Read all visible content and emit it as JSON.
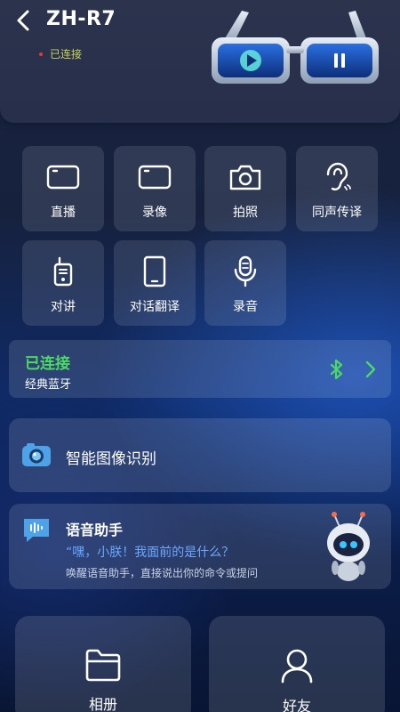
{
  "header": {
    "device_name": "ZH-R7",
    "connection_status": "已连接"
  },
  "features": [
    {
      "label": "直播",
      "icon": "video-camera-icon"
    },
    {
      "label": "录像",
      "icon": "video-record-icon"
    },
    {
      "label": "拍照",
      "icon": "camera-icon"
    },
    {
      "label": "同声传译",
      "icon": "ear-icon"
    },
    {
      "label": "对讲",
      "icon": "walkie-talkie-icon"
    },
    {
      "label": "对话翻译",
      "icon": "phone-icon"
    },
    {
      "label": "录音",
      "icon": "microphone-icon"
    }
  ],
  "bluetooth": {
    "status": "已连接",
    "type": "经典蓝牙",
    "status_color": "#4cd964"
  },
  "image_recognition": {
    "label": "智能图像识别"
  },
  "voice_assistant": {
    "title": "语音助手",
    "prompt": "“嘿，小朕！我面前的是什么？",
    "hint": "唤醒语音助手，直接说出你的命令或提问"
  },
  "bottom": [
    {
      "label": "相册",
      "icon": "folder-icon"
    },
    {
      "label": "好友",
      "icon": "user-icon"
    }
  ],
  "colors": {
    "accent_blue": "#6aa8ff",
    "connected_green": "#4cd964",
    "status_yellow": "#c8d45a"
  }
}
